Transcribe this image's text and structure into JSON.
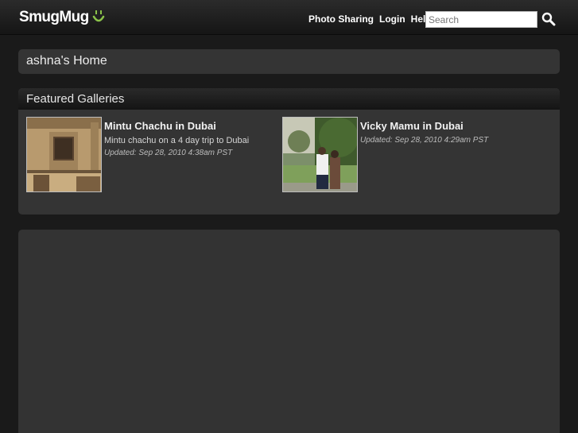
{
  "header": {
    "logo_text": "SmugMug",
    "nav": [
      "Photo Sharing",
      "Login",
      "Help"
    ],
    "search_placeholder": "Search",
    "search_icon": "magnifier-icon"
  },
  "home": {
    "title": "ashna's Home"
  },
  "featured": {
    "title": "Featured Galleries",
    "galleries": [
      {
        "title": "Mintu Chachu in Dubai",
        "description": "Mintu chachu on a 4 day trip to Dubai",
        "updated": "Updated: Sep 28, 2010 4:38am PST"
      },
      {
        "title": "Vicky Mamu in Dubai",
        "description": "",
        "updated": "Updated: Sep 28, 2010 4:29am PST"
      }
    ]
  },
  "colors": {
    "brand_green": "#8bc34a",
    "panel": "#343434",
    "background": "#1a1a1a"
  }
}
